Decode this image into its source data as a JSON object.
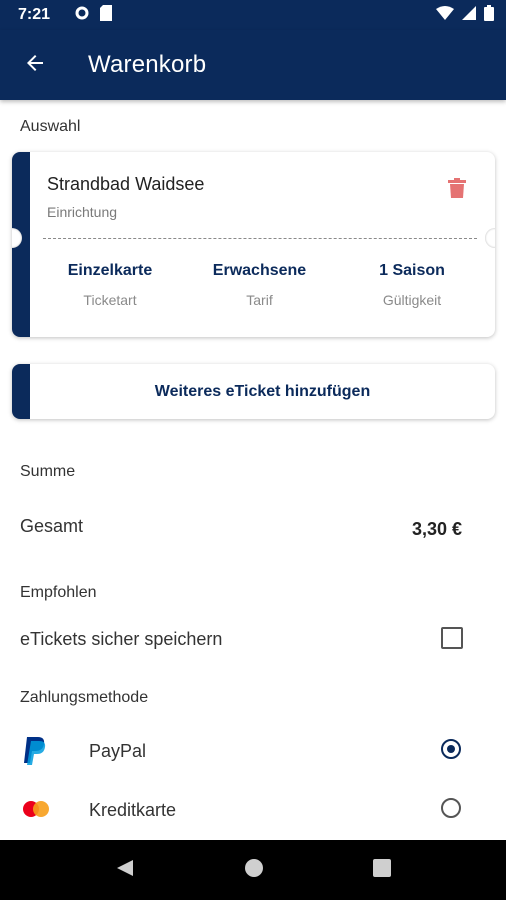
{
  "status": {
    "time": "7:21",
    "icons_left": [
      "gear-icon",
      "sd-card-icon"
    ],
    "icons_right": [
      "wifi-icon",
      "signal-icon",
      "battery-icon"
    ]
  },
  "appbar": {
    "title": "Warenkorb",
    "back_icon": "arrow-back-icon"
  },
  "sections": {
    "selection": "Auswahl",
    "sum": "Summe",
    "recommended": "Empfohlen",
    "payment": "Zahlungsmethode"
  },
  "ticket": {
    "name": "Strandbad Waidsee",
    "type": "Einrichtung",
    "columns": [
      {
        "value": "Einzelkarte",
        "label": "Ticketart"
      },
      {
        "value": "Erwachsene",
        "label": "Tarif"
      },
      {
        "value": "1 Saison",
        "label": "Gültigkeit"
      }
    ]
  },
  "add_ticket": {
    "label": "Weiteres eTicket hinzufügen"
  },
  "total": {
    "label": "Gesamt",
    "value": "3,30 €"
  },
  "recommended_option": {
    "label": "eTickets sicher speichern",
    "checked": false
  },
  "payment_methods": [
    {
      "label": "PayPal",
      "icon": "paypal-icon",
      "selected": true
    },
    {
      "label": "Kreditkarte",
      "icon": "mastercard-icon",
      "selected": false
    }
  ],
  "colors": {
    "primary": "#0b2a5b",
    "trash": "#e57373"
  },
  "navigation": [
    "back-icon",
    "home-icon",
    "recents-icon"
  ]
}
